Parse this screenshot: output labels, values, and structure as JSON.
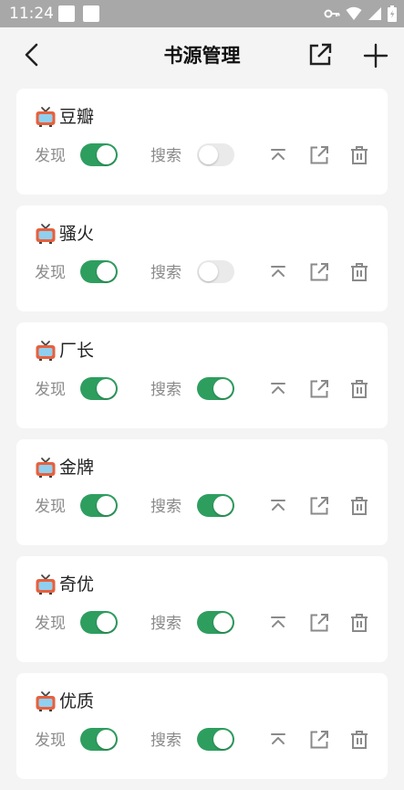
{
  "status_bar": {
    "time": "11:24"
  },
  "app_bar": {
    "title": "书源管理"
  },
  "labels": {
    "discover": "发现",
    "search": "搜索"
  },
  "sources": [
    {
      "name": "豆瓣",
      "discover": true,
      "search": false
    },
    {
      "name": "骚火",
      "discover": true,
      "search": false
    },
    {
      "name": "厂长",
      "discover": true,
      "search": true
    },
    {
      "name": "金牌",
      "discover": true,
      "search": true
    },
    {
      "name": "奇优",
      "discover": true,
      "search": true
    },
    {
      "name": "优质",
      "discover": true,
      "search": true
    }
  ],
  "colors": {
    "toggle_on": "#2e9e5f",
    "toggle_off": "#eaeaea",
    "icon_gray": "#8a8a8a",
    "tv_red": "#e8603c"
  },
  "icons": [
    "back-icon",
    "export-icon",
    "add-icon",
    "tv-icon",
    "pin-top-icon",
    "share-icon",
    "delete-icon"
  ]
}
